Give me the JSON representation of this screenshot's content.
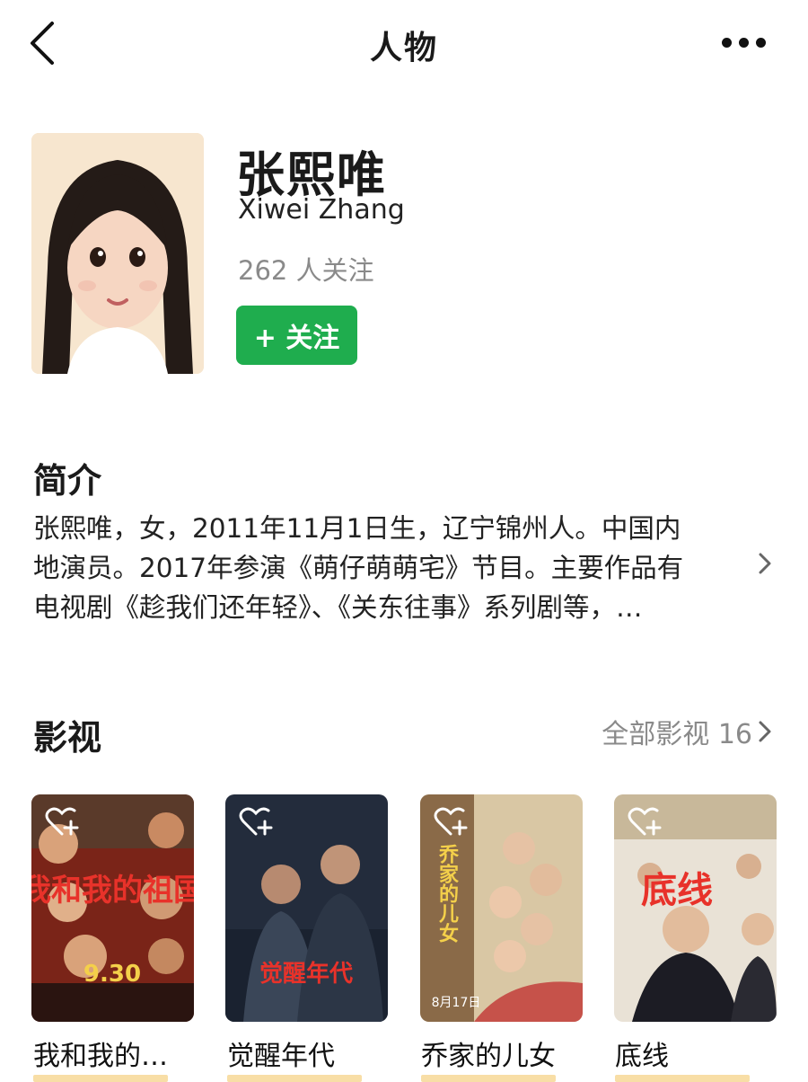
{
  "header": {
    "title": "人物"
  },
  "person": {
    "name": "张熙唯",
    "english_name": "Xiwei Zhang",
    "followers": "262 人关注",
    "follow_label": "+ 关注"
  },
  "intro": {
    "heading": "简介",
    "lines": [
      "张熙唯，女，2011年11月1日生，辽宁锦州人。中国内",
      "地演员。2017年参演《萌仔萌萌宅》节目。主要作品有",
      "电视剧《趁我们还年轻》、《关东往事》系列剧等，…"
    ]
  },
  "films": {
    "heading": "影视",
    "all_label": "全部影视 16",
    "items": [
      {
        "title": "我和我的…",
        "poster_text": "我和我的祖国",
        "poster_date": "9.30"
      },
      {
        "title": "觉醒年代",
        "poster_text": "觉醒年代"
      },
      {
        "title": "乔家的儿女",
        "poster_text": "乔家的儿女",
        "poster_date": "8月17日"
      },
      {
        "title": "底线",
        "poster_text": "底线"
      }
    ]
  },
  "colors": {
    "accent": "#1fad4e",
    "muted": "#8a8a8a"
  }
}
